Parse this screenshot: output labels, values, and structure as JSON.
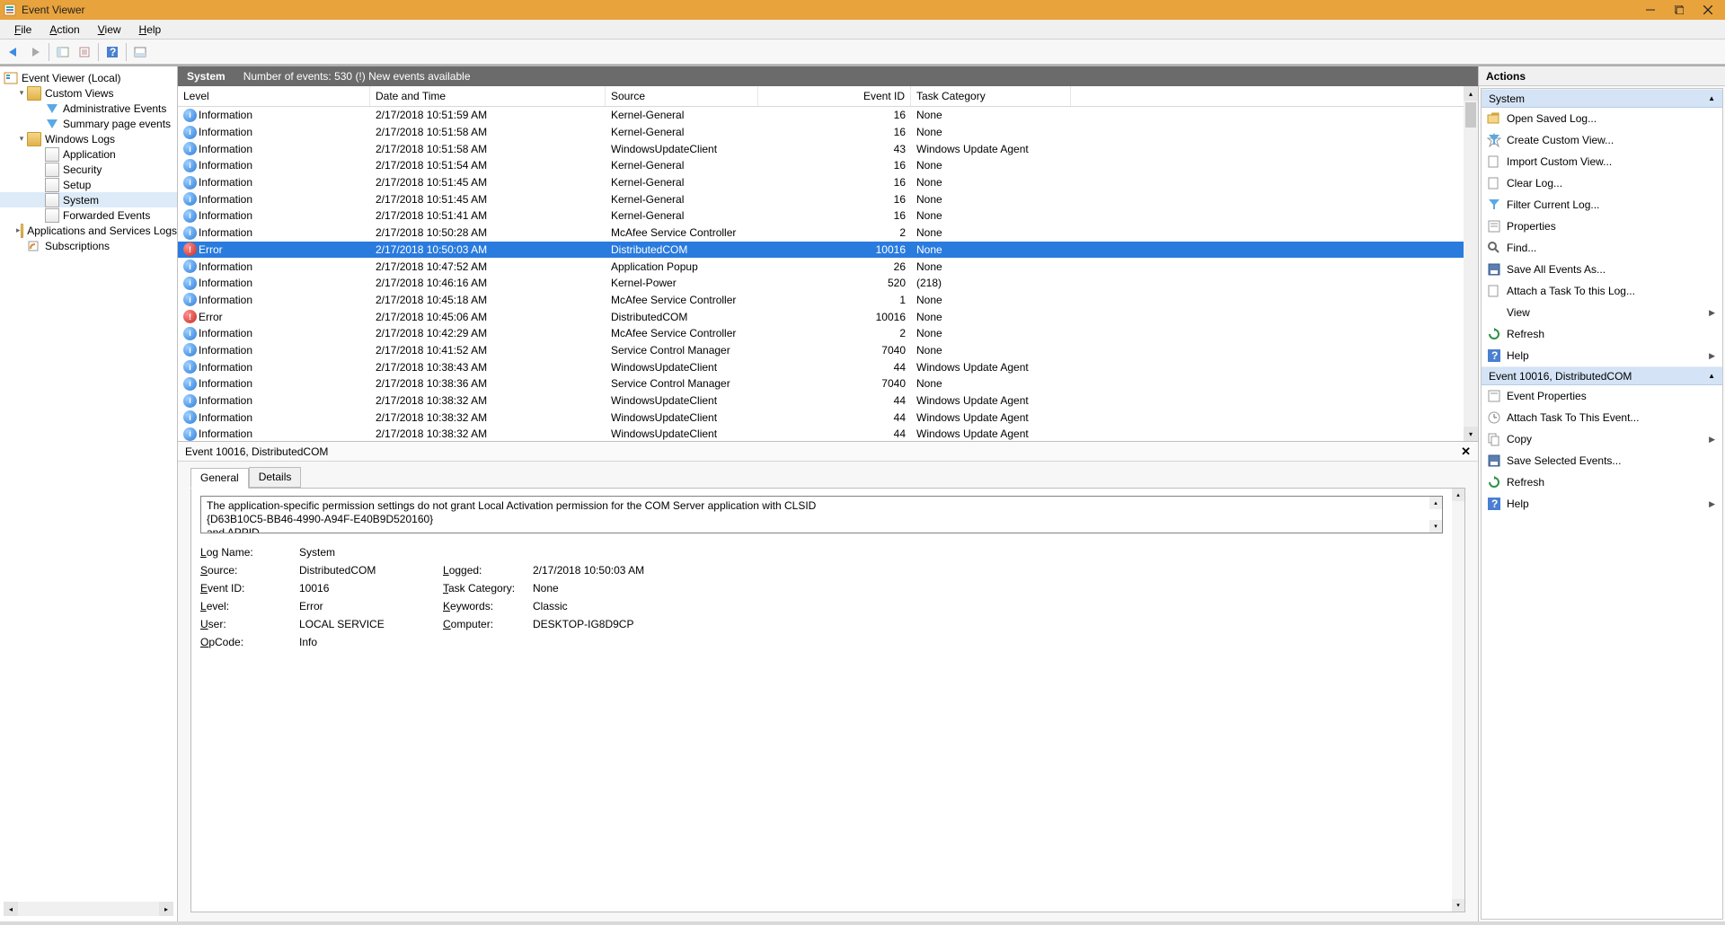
{
  "window": {
    "title": "Event Viewer"
  },
  "menu": {
    "file": "File",
    "action": "Action",
    "view": "View",
    "help": "Help"
  },
  "tree": {
    "root": "Event Viewer (Local)",
    "customviews": "Custom Views",
    "adminEvents": "Administrative Events",
    "summaryPage": "Summary page events",
    "winlogs": "Windows Logs",
    "application": "Application",
    "security": "Security",
    "setup": "Setup",
    "system": "System",
    "forwarded": "Forwarded Events",
    "appsservices": "Applications and Services Logs",
    "subscriptions": "Subscriptions"
  },
  "center": {
    "logname": "System",
    "countText": "Number of events: 530 (!) New events available",
    "columns": {
      "level": "Level",
      "date": "Date and Time",
      "source": "Source",
      "eventid": "Event ID",
      "task": "Task Category"
    }
  },
  "events": [
    {
      "level": "Information",
      "date": "2/17/2018 10:51:59 AM",
      "source": "Kernel-General",
      "id": "16",
      "task": "None",
      "sel": false,
      "err": false
    },
    {
      "level": "Information",
      "date": "2/17/2018 10:51:58 AM",
      "source": "Kernel-General",
      "id": "16",
      "task": "None",
      "sel": false,
      "err": false
    },
    {
      "level": "Information",
      "date": "2/17/2018 10:51:58 AM",
      "source": "WindowsUpdateClient",
      "id": "43",
      "task": "Windows Update Agent",
      "sel": false,
      "err": false
    },
    {
      "level": "Information",
      "date": "2/17/2018 10:51:54 AM",
      "source": "Kernel-General",
      "id": "16",
      "task": "None",
      "sel": false,
      "err": false
    },
    {
      "level": "Information",
      "date": "2/17/2018 10:51:45 AM",
      "source": "Kernel-General",
      "id": "16",
      "task": "None",
      "sel": false,
      "err": false
    },
    {
      "level": "Information",
      "date": "2/17/2018 10:51:45 AM",
      "source": "Kernel-General",
      "id": "16",
      "task": "None",
      "sel": false,
      "err": false
    },
    {
      "level": "Information",
      "date": "2/17/2018 10:51:41 AM",
      "source": "Kernel-General",
      "id": "16",
      "task": "None",
      "sel": false,
      "err": false
    },
    {
      "level": "Information",
      "date": "2/17/2018 10:50:28 AM",
      "source": "McAfee Service Controller",
      "id": "2",
      "task": "None",
      "sel": false,
      "err": false
    },
    {
      "level": "Error",
      "date": "2/17/2018 10:50:03 AM",
      "source": "DistributedCOM",
      "id": "10016",
      "task": "None",
      "sel": true,
      "err": true
    },
    {
      "level": "Information",
      "date": "2/17/2018 10:47:52 AM",
      "source": "Application Popup",
      "id": "26",
      "task": "None",
      "sel": false,
      "err": false
    },
    {
      "level": "Information",
      "date": "2/17/2018 10:46:16 AM",
      "source": "Kernel-Power",
      "id": "520",
      "task": "(218)",
      "sel": false,
      "err": false
    },
    {
      "level": "Information",
      "date": "2/17/2018 10:45:18 AM",
      "source": "McAfee Service Controller",
      "id": "1",
      "task": "None",
      "sel": false,
      "err": false
    },
    {
      "level": "Error",
      "date": "2/17/2018 10:45:06 AM",
      "source": "DistributedCOM",
      "id": "10016",
      "task": "None",
      "sel": false,
      "err": true
    },
    {
      "level": "Information",
      "date": "2/17/2018 10:42:29 AM",
      "source": "McAfee Service Controller",
      "id": "2",
      "task": "None",
      "sel": false,
      "err": false
    },
    {
      "level": "Information",
      "date": "2/17/2018 10:41:52 AM",
      "source": "Service Control Manager",
      "id": "7040",
      "task": "None",
      "sel": false,
      "err": false
    },
    {
      "level": "Information",
      "date": "2/17/2018 10:38:43 AM",
      "source": "WindowsUpdateClient",
      "id": "44",
      "task": "Windows Update Agent",
      "sel": false,
      "err": false
    },
    {
      "level": "Information",
      "date": "2/17/2018 10:38:36 AM",
      "source": "Service Control Manager",
      "id": "7040",
      "task": "None",
      "sel": false,
      "err": false
    },
    {
      "level": "Information",
      "date": "2/17/2018 10:38:32 AM",
      "source": "WindowsUpdateClient",
      "id": "44",
      "task": "Windows Update Agent",
      "sel": false,
      "err": false
    },
    {
      "level": "Information",
      "date": "2/17/2018 10:38:32 AM",
      "source": "WindowsUpdateClient",
      "id": "44",
      "task": "Windows Update Agent",
      "sel": false,
      "err": false
    },
    {
      "level": "Information",
      "date": "2/17/2018 10:38:32 AM",
      "source": "WindowsUpdateClient",
      "id": "44",
      "task": "Windows Update Agent",
      "sel": false,
      "err": false
    }
  ],
  "detail": {
    "header": "Event 10016, DistributedCOM",
    "tabs": {
      "general": "General",
      "details": "Details"
    },
    "message_l1": "The application-specific permission settings do not grant Local Activation permission for the COM Server application with CLSID",
    "message_l2": "{D63B10C5-BB46-4990-A94F-E40B9D520160}",
    "message_l3": "and APPID",
    "labels": {
      "logname": "Log Name:",
      "source": "Source:",
      "eventid": "Event ID:",
      "level": "Level:",
      "user": "User:",
      "opcode": "OpCode:",
      "logged": "Logged:",
      "taskcat": "Task Category:",
      "keywords": "Keywords:",
      "computer": "Computer:"
    },
    "values": {
      "logname": "System",
      "source": "DistributedCOM",
      "eventid": "10016",
      "level": "Error",
      "user": "LOCAL SERVICE",
      "opcode": "Info",
      "logged": "2/17/2018 10:50:03 AM",
      "taskcat": "None",
      "keywords": "Classic",
      "computer": "DESKTOP-IG8D9CP"
    }
  },
  "actions": {
    "header": "Actions",
    "group1": "System",
    "items1": [
      "Open Saved Log...",
      "Create Custom View...",
      "Import Custom View...",
      "Clear Log...",
      "Filter Current Log...",
      "Properties",
      "Find...",
      "Save All Events As...",
      "Attach a Task To this Log...",
      "View",
      "Refresh",
      "Help"
    ],
    "group2": "Event 10016, DistributedCOM",
    "items2": [
      "Event Properties",
      "Attach Task To This Event...",
      "Copy",
      "Save Selected Events...",
      "Refresh",
      "Help"
    ]
  }
}
